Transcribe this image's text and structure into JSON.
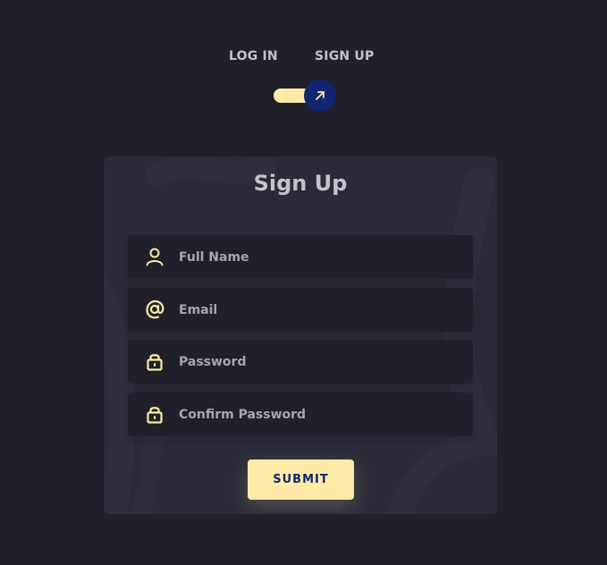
{
  "tabs": {
    "login_label": "LOG IN",
    "signup_label": "SIGN UP"
  },
  "toggle": {
    "checked": true,
    "icon": "arrow-up-right-icon"
  },
  "form": {
    "title": "Sign Up",
    "fields": [
      {
        "placeholder": "Full Name",
        "value": "",
        "icon": "user-icon"
      },
      {
        "placeholder": "Email",
        "value": "",
        "icon": "at-icon"
      },
      {
        "placeholder": "Password",
        "value": "",
        "icon": "lock-icon"
      },
      {
        "placeholder": "Confirm Password",
        "value": "",
        "icon": "lock-icon"
      }
    ],
    "submit_label": "SUBMIT"
  },
  "colors": {
    "background": "#1f2029",
    "card": "#2a2b38",
    "accent": "#ffeba7",
    "knob": "#102770",
    "text": "#c4c3ca"
  }
}
